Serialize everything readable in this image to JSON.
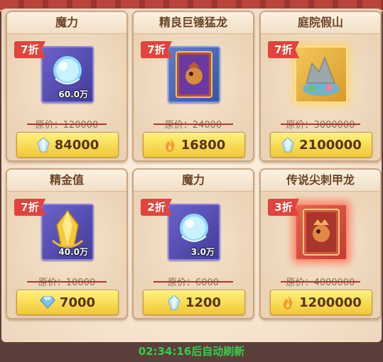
{
  "cards": [
    {
      "title": "魔力",
      "discount": "7折",
      "amount": "60.0万",
      "original": "原价：120000",
      "price": "84000",
      "currency_icon": "crystal-icon",
      "item_icon": "mana-orb-icon"
    },
    {
      "title": "精良巨锤猛龙",
      "discount": "7折",
      "amount": "",
      "original": "原价：24000",
      "price": "16800",
      "currency_icon": "flame-icon",
      "item_icon": "dragon-card-icon"
    },
    {
      "title": "庭院假山",
      "discount": "7折",
      "amount": "",
      "original": "原价：3000000",
      "price": "2100000",
      "currency_icon": "crystal-icon",
      "item_icon": "rockery-icon"
    },
    {
      "title": "精金值",
      "discount": "7折",
      "amount": "40.0万",
      "original": "原价：10000",
      "price": "7000",
      "currency_icon": "diamond-icon",
      "item_icon": "gold-crystal-icon"
    },
    {
      "title": "魔力",
      "discount": "2折",
      "amount": "3.0万",
      "original": "原价：6000",
      "price": "1200",
      "currency_icon": "crystal-icon",
      "item_icon": "mana-orb-icon"
    },
    {
      "title": "传说尖刺甲龙",
      "discount": "3折",
      "amount": "",
      "original": "原价：4000000",
      "price": "1200000",
      "currency_icon": "flame-icon",
      "item_icon": "dragon-card-icon"
    }
  ],
  "footer": {
    "refresh_text": "02:34:16后自动刷新"
  },
  "colors": {
    "discount_tag": "#e2433c",
    "timer": "#32d04a",
    "price_button": "#f1c738"
  }
}
